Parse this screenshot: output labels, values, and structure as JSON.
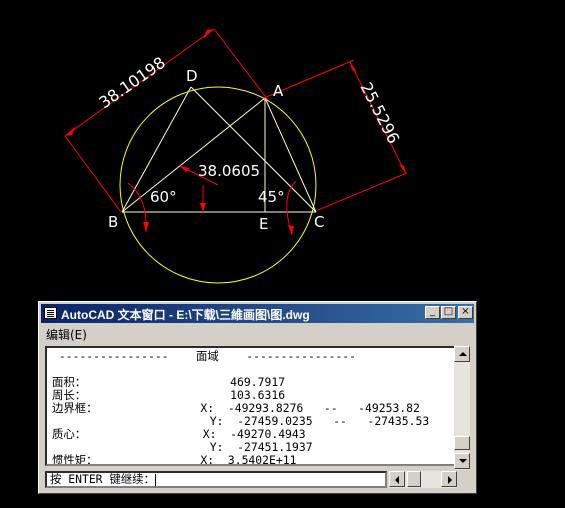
{
  "drawing": {
    "points": {
      "B": "B",
      "E": "E",
      "C": "C",
      "D": "D",
      "A": "A"
    },
    "dims": {
      "aligned_ba": "38.10198",
      "aligned_ac": "25.5296",
      "radius": "38.0605",
      "angle_b": "60°",
      "angle_c": "45°"
    },
    "colors": {
      "circle": "#ffff00",
      "lines": "#ffffcc",
      "dims": "#ff0000",
      "background": "#000000"
    }
  },
  "window": {
    "title": "AutoCAD 文本窗口 - E:\\下载\\三維画图\\图.dwg",
    "menu_edit": "编辑(E)",
    "btn_min": "_",
    "btn_max": "□",
    "btn_close": "×",
    "lines": [
      " ----------------    面域    ----------------",
      "",
      "面积：                     469.7917",
      "周长：                     103.6316",
      "边界框：               X:  -49293.8276   --   -49253.82",
      "                       Y:  -27459.0235   --   -27435.53",
      "质心：                 X:  -49270.4943",
      "                       Y:  -27451.1937",
      "惯性矩：               X:  3.5402E+11"
    ],
    "command_prompt": "按 ENTER 键继续："
  }
}
